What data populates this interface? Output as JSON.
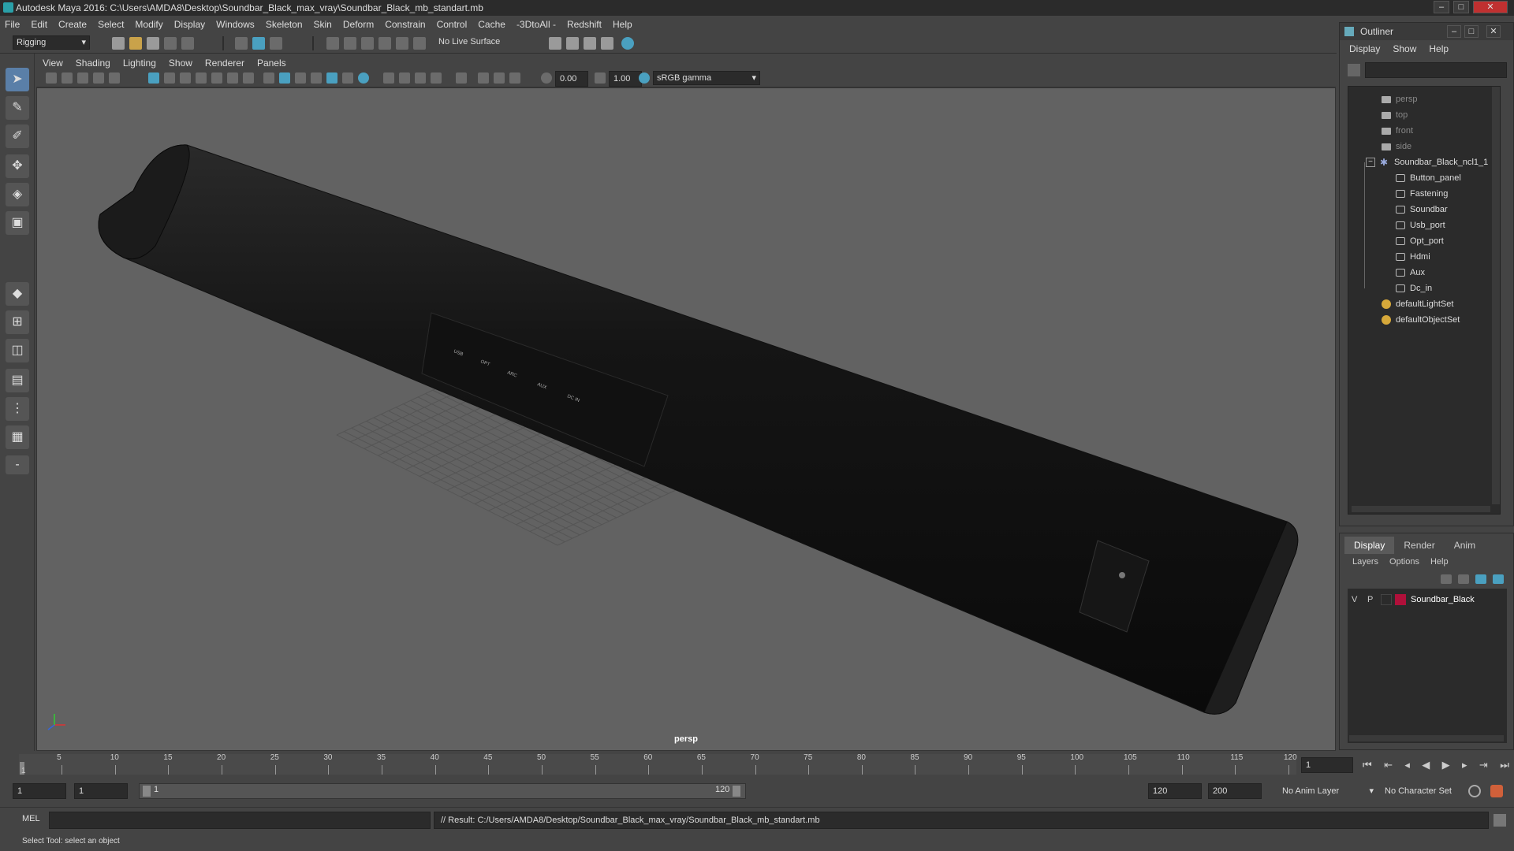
{
  "title": "Autodesk Maya 2016: C:\\Users\\AMDA8\\Desktop\\Soundbar_Black_max_vray\\Soundbar_Black_mb_standart.mb",
  "main_menu": [
    "File",
    "Edit",
    "Create",
    "Select",
    "Modify",
    "Display",
    "Windows",
    "Skeleton",
    "Skin",
    "Deform",
    "Constrain",
    "Control",
    "Cache",
    "-3DtoAll -",
    "Redshift",
    "Help"
  ],
  "shelf": {
    "mode": "Rigging",
    "live_surface": "No Live Surface"
  },
  "viewport": {
    "menu": [
      "View",
      "Shading",
      "Lighting",
      "Show",
      "Renderer",
      "Panels"
    ],
    "exposure": "0.00",
    "gamma": "1.00",
    "color_space": "sRGB gamma",
    "camera": "persp"
  },
  "outliner": {
    "title": "Outliner",
    "menu": [
      "Display",
      "Show",
      "Help"
    ],
    "items": [
      {
        "label": "persp",
        "type": "camera"
      },
      {
        "label": "top",
        "type": "camera"
      },
      {
        "label": "front",
        "type": "camera"
      },
      {
        "label": "side",
        "type": "camera"
      },
      {
        "label": "Soundbar_Black_ncl1_1",
        "type": "group"
      },
      {
        "label": "Button_panel",
        "type": "mesh"
      },
      {
        "label": "Fastening",
        "type": "mesh"
      },
      {
        "label": "Soundbar",
        "type": "mesh"
      },
      {
        "label": "Usb_port",
        "type": "mesh"
      },
      {
        "label": "Opt_port",
        "type": "mesh"
      },
      {
        "label": "Hdmi",
        "type": "mesh"
      },
      {
        "label": "Aux",
        "type": "mesh"
      },
      {
        "label": "Dc_in",
        "type": "mesh"
      },
      {
        "label": "defaultLightSet",
        "type": "set"
      },
      {
        "label": "defaultObjectSet",
        "type": "set"
      }
    ]
  },
  "layer_editor": {
    "tabs": [
      "Display",
      "Render",
      "Anim"
    ],
    "menu": [
      "Layers",
      "Options",
      "Help"
    ],
    "layer": {
      "v": "V",
      "p": "P",
      "name": "Soundbar_Black",
      "color": "#b0103a"
    }
  },
  "time_slider": {
    "ticks": [
      "5",
      "10",
      "15",
      "20",
      "25",
      "30",
      "35",
      "40",
      "45",
      "50",
      "55",
      "60",
      "65",
      "70",
      "75",
      "80",
      "85",
      "90",
      "95",
      "100",
      "105",
      "110",
      "115",
      "120"
    ],
    "start_label": "1",
    "current_frame": "1"
  },
  "range": {
    "start": "1",
    "playback_start": "1",
    "range_start": "1",
    "range_end": "120",
    "playback_end": "120",
    "end": "200",
    "anim_layer": "No Anim Layer",
    "character_set": "No Character Set"
  },
  "command": {
    "lang": "MEL",
    "result": "// Result: C:/Users/AMDA8/Desktop/Soundbar_Black_max_vray/Soundbar_Black_mb_standart.mb"
  },
  "help_line": "Select Tool: select an object",
  "soundbar_labels": [
    "USB",
    "OPT",
    "ARC",
    "AUX",
    "DC IN"
  ]
}
